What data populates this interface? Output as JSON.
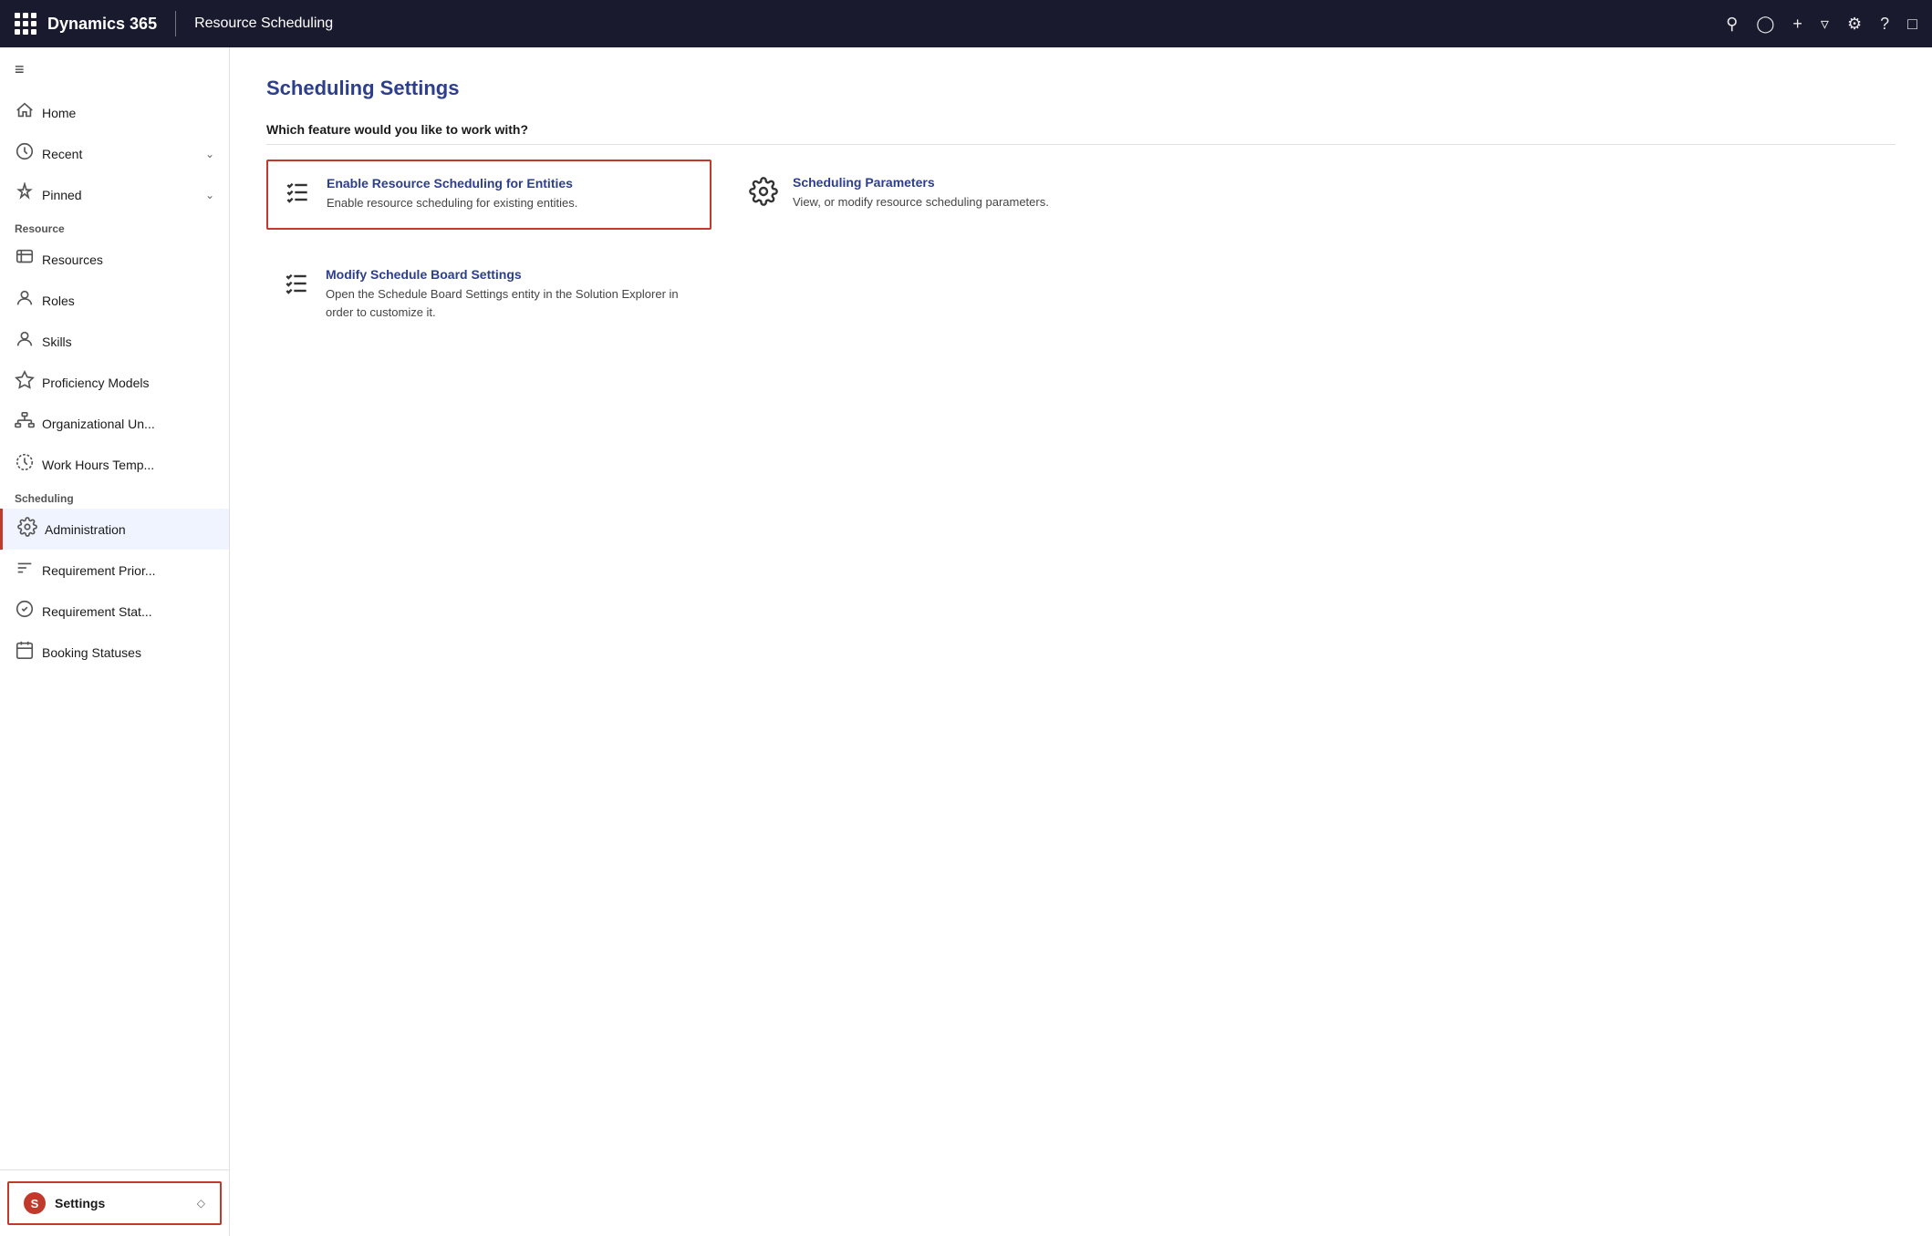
{
  "topnav": {
    "brand": "Dynamics 365",
    "module": "Resource Scheduling",
    "icons": [
      "search",
      "lightbulb",
      "plus",
      "filter",
      "gear",
      "question",
      "chat"
    ]
  },
  "sidebar": {
    "toggle_label": "≡",
    "sections": [
      {
        "label": "",
        "items": [
          {
            "id": "home",
            "icon": "home",
            "label": "Home",
            "hasChevron": false
          },
          {
            "id": "recent",
            "icon": "clock",
            "label": "Recent",
            "hasChevron": true
          },
          {
            "id": "pinned",
            "icon": "pin",
            "label": "Pinned",
            "hasChevron": true
          }
        ]
      },
      {
        "label": "Resource",
        "items": [
          {
            "id": "resources",
            "icon": "resource",
            "label": "Resources",
            "hasChevron": false
          },
          {
            "id": "roles",
            "icon": "role",
            "label": "Roles",
            "hasChevron": false
          },
          {
            "id": "skills",
            "icon": "skill",
            "label": "Skills",
            "hasChevron": false
          },
          {
            "id": "proficiency",
            "icon": "star",
            "label": "Proficiency Models",
            "hasChevron": false
          },
          {
            "id": "orgunit",
            "icon": "org",
            "label": "Organizational Un...",
            "hasChevron": false
          },
          {
            "id": "workhours",
            "icon": "workhours",
            "label": "Work Hours Temp...",
            "hasChevron": false
          }
        ]
      },
      {
        "label": "Scheduling",
        "items": [
          {
            "id": "administration",
            "icon": "gear",
            "label": "Administration",
            "hasChevron": false,
            "active": true
          },
          {
            "id": "reqpriority",
            "icon": "reqpriority",
            "label": "Requirement Prior...",
            "hasChevron": false
          },
          {
            "id": "reqstatus",
            "icon": "reqstatus",
            "label": "Requirement Stat...",
            "hasChevron": false
          },
          {
            "id": "booking",
            "icon": "booking",
            "label": "Booking Statuses",
            "hasChevron": false
          }
        ]
      }
    ],
    "bottom": {
      "badge": "S",
      "label": "Settings",
      "chevron": "◇"
    }
  },
  "content": {
    "page_title": "Scheduling Settings",
    "section_question": "Which feature would you like to work with?",
    "features": [
      {
        "id": "enable-resource-scheduling",
        "icon": "checklist",
        "title": "Enable Resource Scheduling for Entities",
        "description": "Enable resource scheduling for existing entities.",
        "selected": true
      },
      {
        "id": "scheduling-parameters",
        "icon": "gear",
        "title": "Scheduling Parameters",
        "description": "View, or modify resource scheduling parameters.",
        "selected": false
      },
      {
        "id": "modify-schedule-board",
        "icon": "checklist",
        "title": "Modify Schedule Board Settings",
        "description": "Open the Schedule Board Settings entity in the Solution Explorer in order to customize it.",
        "selected": false
      }
    ]
  }
}
